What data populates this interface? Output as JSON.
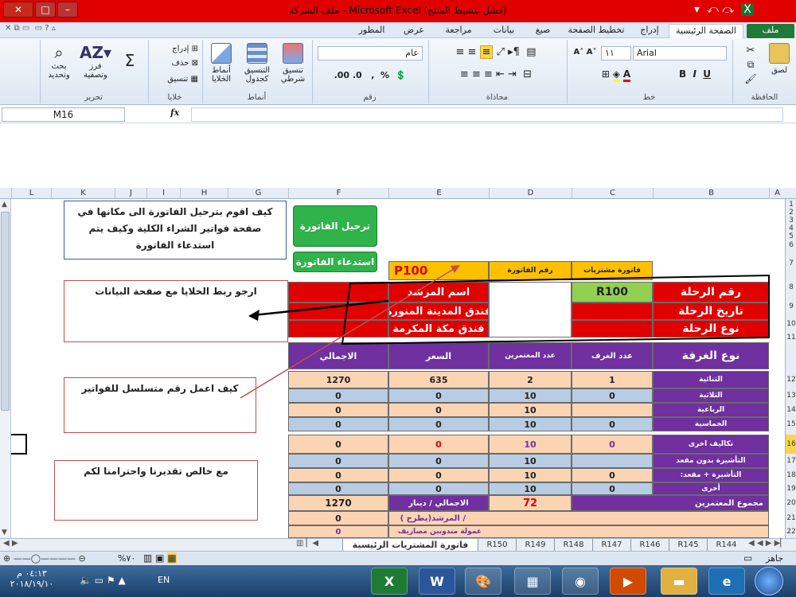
{
  "window": {
    "title": "ملف الشركة  -  Microsoft Excel  (فشل تنشيط المنتج)"
  },
  "ribbon_tabs": [
    "ملف",
    "الصفحة الرئيسية",
    "إدراج",
    "تخطيط الصفحة",
    "صيغ",
    "بيانات",
    "مراجعة",
    "عرض",
    "المطور"
  ],
  "ribbon": {
    "groups": {
      "clipboard": "الحافظة",
      "font": "خط",
      "alignment": "محاذاة",
      "number": "رقم",
      "styles": "أنماط",
      "cells": "خلايا",
      "editing": "تحرير"
    },
    "paste": "لصق",
    "font_name": "Arial",
    "font_size": "١١",
    "number_format": "عام",
    "cond_format": "تنسيق شرطي",
    "format_table": "التنسيق كجدول",
    "cell_styles": "أنماط الخلايا",
    "insert": "إدراج",
    "delete": "حذف",
    "format": "تنسيق",
    "sort_filter": "فرز وتصفية",
    "find_select": "بحث وتحديد"
  },
  "formula_bar": {
    "name_box": "M16",
    "fx": "fx",
    "value": ""
  },
  "columns": [
    "L",
    "K",
    "J",
    "I",
    "H",
    "G",
    "F",
    "E",
    "D",
    "C",
    "B",
    "A"
  ],
  "rows": [
    "1",
    "2",
    "3",
    "4",
    "5",
    "6",
    "7",
    "8",
    "9",
    "10",
    "11",
    "12",
    "13",
    "14",
    "15",
    "16",
    "17",
    "18",
    "19",
    "20",
    "21",
    "22"
  ],
  "buttons": {
    "transfer": "ترحيل الفاتورة",
    "recall": "استدعاء الفاتورة"
  },
  "notes": {
    "q1": "كيف اقوم بترحيل الفاتورة الى مكانها في صفحة فواتير الشراء الكلية  وكيف  يتم استدعاء الفاتورة",
    "q2": "ارجو  ربط الخلايا مع صفحة البيانات",
    "q3": "كيف اعمل رقم متسلسل للفواتير",
    "q4": "مع خالص تقديرنا واحترامنا  لكم"
  },
  "invoice": {
    "p_code": "P100",
    "invoice_no_label": "رقم الفاتورة",
    "purchase_label": "فاتورة مشتريات",
    "trip_no_label": "رقم الرحلة",
    "trip_no": "R100",
    "trip_date_label": "تاريخ الرحلة",
    "trip_type_label": "نوع الرحلة",
    "guide_label": "اسم المرشد",
    "hotel_madinah": "فندق المدينة المنورة",
    "hotel_makkah": "فندق مكة المكرمة",
    "headers": {
      "room_type": "نوع الغرفة",
      "rooms": "عدد الغرف",
      "pilgrims": "عدد المعتمرين",
      "price": "السعر",
      "total": "الاجمالي"
    },
    "rows": [
      {
        "label": "الثنائية",
        "rooms": "1",
        "pilgrims": "2",
        "price": "635",
        "total": "1270"
      },
      {
        "label": "الثلاثية",
        "rooms": "0",
        "pilgrims": "10",
        "price": "0",
        "total": "0"
      },
      {
        "label": "الرباعية",
        "rooms": "",
        "pilgrims": "10",
        "price": "0",
        "total": "0"
      },
      {
        "label": "الخماسية",
        "rooms": "0",
        "pilgrims": "10",
        "price": "0",
        "total": "0"
      },
      {
        "label": "تكاليف اخرى",
        "rooms": "0",
        "pilgrims": "10",
        "price": "0",
        "total": "0"
      },
      {
        "label": "التأشيرة بدون مقعد",
        "rooms": "",
        "pilgrims": "10",
        "price": "0",
        "total": "0"
      },
      {
        "label": ":التأشيرة + مقعد",
        "rooms": "0",
        "pilgrims": "10",
        "price": "0",
        "total": "0"
      },
      {
        "label": "أخرى",
        "rooms": "0",
        "pilgrims": "10",
        "price": "0",
        "total": "0"
      }
    ],
    "sum_pilgrims_label": "مجموع المعتمرين",
    "sum_pilgrims": "72",
    "total_dinar_label": "الاجمالي / دينار",
    "total_dinar": "1270",
    "row21_label": "(  يطرح)المرشد /",
    "row21_val": "0",
    "row22_label": "عمولة مندوبين مصاريف",
    "row22_val": "0"
  },
  "sheet_tabs": [
    "R144",
    "R145",
    "R146",
    "R147",
    "R148",
    "R149",
    "R150",
    "فاتورة المشتريات الرئيسية"
  ],
  "status": {
    "ready": "جاهز",
    "zoom": "%٧٠"
  },
  "taskbar": {
    "time": "٠٤:١٣ م",
    "date": "٢٠١٨/١٩/١٠",
    "lang": "EN"
  }
}
